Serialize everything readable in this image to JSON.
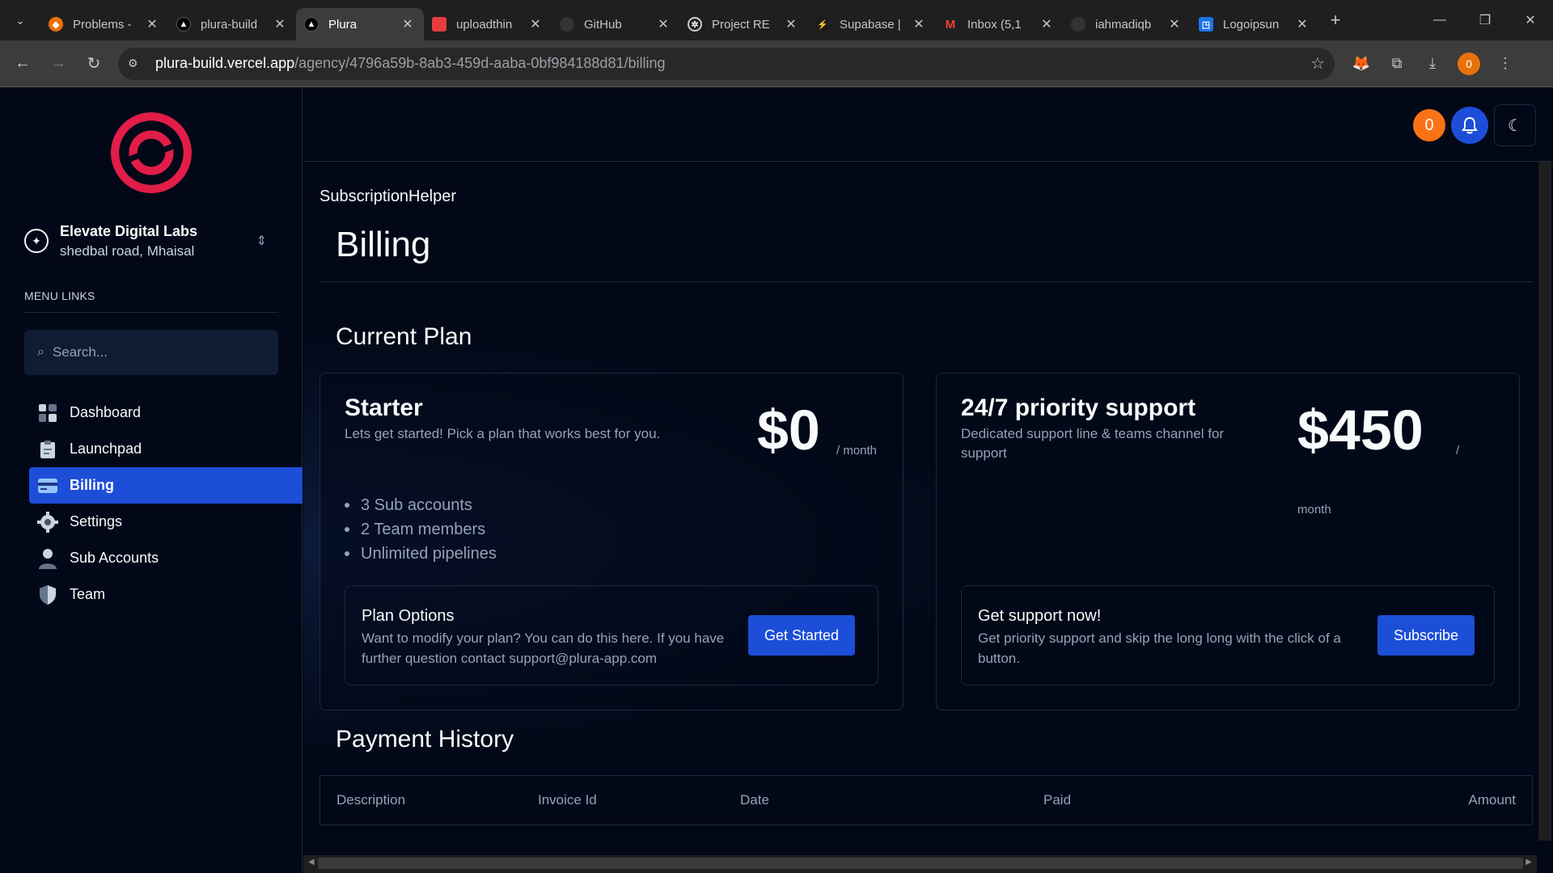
{
  "browser": {
    "tabs": [
      {
        "label": "Problems -",
        "icon": "git-icon",
        "color": "#e8710a",
        "active": false
      },
      {
        "label": "plura-build",
        "icon": "vercel-icon",
        "color": "#ffffff",
        "active": false
      },
      {
        "label": "Plura",
        "icon": "vercel-icon",
        "color": "#ffffff",
        "active": true
      },
      {
        "label": "uploadthin",
        "icon": "uploadthing-icon",
        "color": "#e53e3e",
        "active": false
      },
      {
        "label": "GitHub",
        "icon": "github-icon",
        "color": "#444444",
        "active": false
      },
      {
        "label": "Project RE",
        "icon": "openai-icon",
        "color": "#888888",
        "active": false
      },
      {
        "label": "Supabase |",
        "icon": "supabase-icon",
        "color": "#3ecf8e",
        "active": false
      },
      {
        "label": "Inbox (5,1",
        "icon": "gmail-icon",
        "color": "#ea4335",
        "active": false
      },
      {
        "label": "iahmadiqb",
        "icon": "github-icon",
        "color": "#444444",
        "active": false
      },
      {
        "label": "Logoipsun",
        "icon": "logoipsum-icon",
        "color": "#1a73e8",
        "active": false
      }
    ],
    "url_host": "plura-build.vercel.app",
    "url_path": "/agency/4796a59b-8ab3-459d-aaba-0bf984188d81/billing",
    "profile_initial": "0"
  },
  "sidebar": {
    "agency_name": "Elevate Digital Labs",
    "agency_address": "shedbal road, Mhaisal",
    "menu_title": "MENU LINKS",
    "search_placeholder": "Search...",
    "items": [
      {
        "label": "Dashboard",
        "icon": "dashboard-icon",
        "active": false
      },
      {
        "label": "Launchpad",
        "icon": "clipboard-icon",
        "active": false
      },
      {
        "label": "Billing",
        "icon": "credit-card-icon",
        "active": true
      },
      {
        "label": "Settings",
        "icon": "gear-icon",
        "active": false
      },
      {
        "label": "Sub Accounts",
        "icon": "person-icon",
        "active": false
      },
      {
        "label": "Team",
        "icon": "shield-icon",
        "active": false
      }
    ]
  },
  "topbar": {
    "avatar_initial": "0"
  },
  "main": {
    "helper": "SubscriptionHelper",
    "title": "Billing",
    "current_plan_title": "Current Plan",
    "payment_history_title": "Payment History",
    "cards": [
      {
        "title": "Starter",
        "description": "Lets get started! Pick a plan that works best for you.",
        "price": "$0",
        "period": "/ month",
        "features": [
          "3 Sub accounts",
          "2 Team members",
          "Unlimited pipelines"
        ],
        "inner_title": "Plan Options",
        "inner_desc": "Want to modify your plan? You can do this here. If you have further question contact support@plura-app.com",
        "button": "Get Started"
      },
      {
        "title": "24/7 priority support",
        "description": "Dedicated support line & teams channel for support",
        "price": "$450",
        "period_slash": "/",
        "period_word": "month",
        "inner_title": "Get support now!",
        "inner_desc": "Get priority support and skip the long long with the click of a button.",
        "button": "Subscribe"
      }
    ],
    "table_headers": [
      "Description",
      "Invoice Id",
      "Date",
      "Paid",
      "Amount"
    ]
  },
  "colors": {
    "accent": "#1d4ed8",
    "avatar": "#f97316",
    "logo": "#e11d48"
  }
}
